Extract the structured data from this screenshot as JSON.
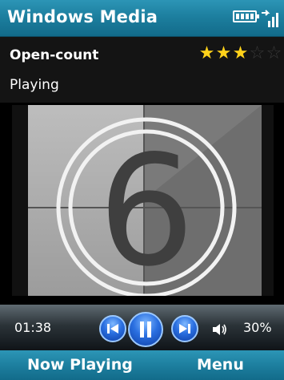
{
  "app": {
    "title": "Windows Media"
  },
  "status_bar": {
    "battery_icon": "battery-icon",
    "signal_icon": "signal-icon"
  },
  "track": {
    "name": "Open-count",
    "state": "Playing",
    "rating": {
      "value": 3,
      "max": 5
    }
  },
  "video": {
    "frame_number": "6"
  },
  "controls": {
    "elapsed": "01:38",
    "volume": "30%",
    "buttons": [
      "previous-icon",
      "pause-icon",
      "next-icon",
      "speaker-icon"
    ]
  },
  "softkeys": {
    "left": "Now Playing",
    "right": "Menu"
  },
  "colors": {
    "accent": "#1d7f9f",
    "star": "#ffd21a",
    "control_blue": "#2a6fe0"
  }
}
